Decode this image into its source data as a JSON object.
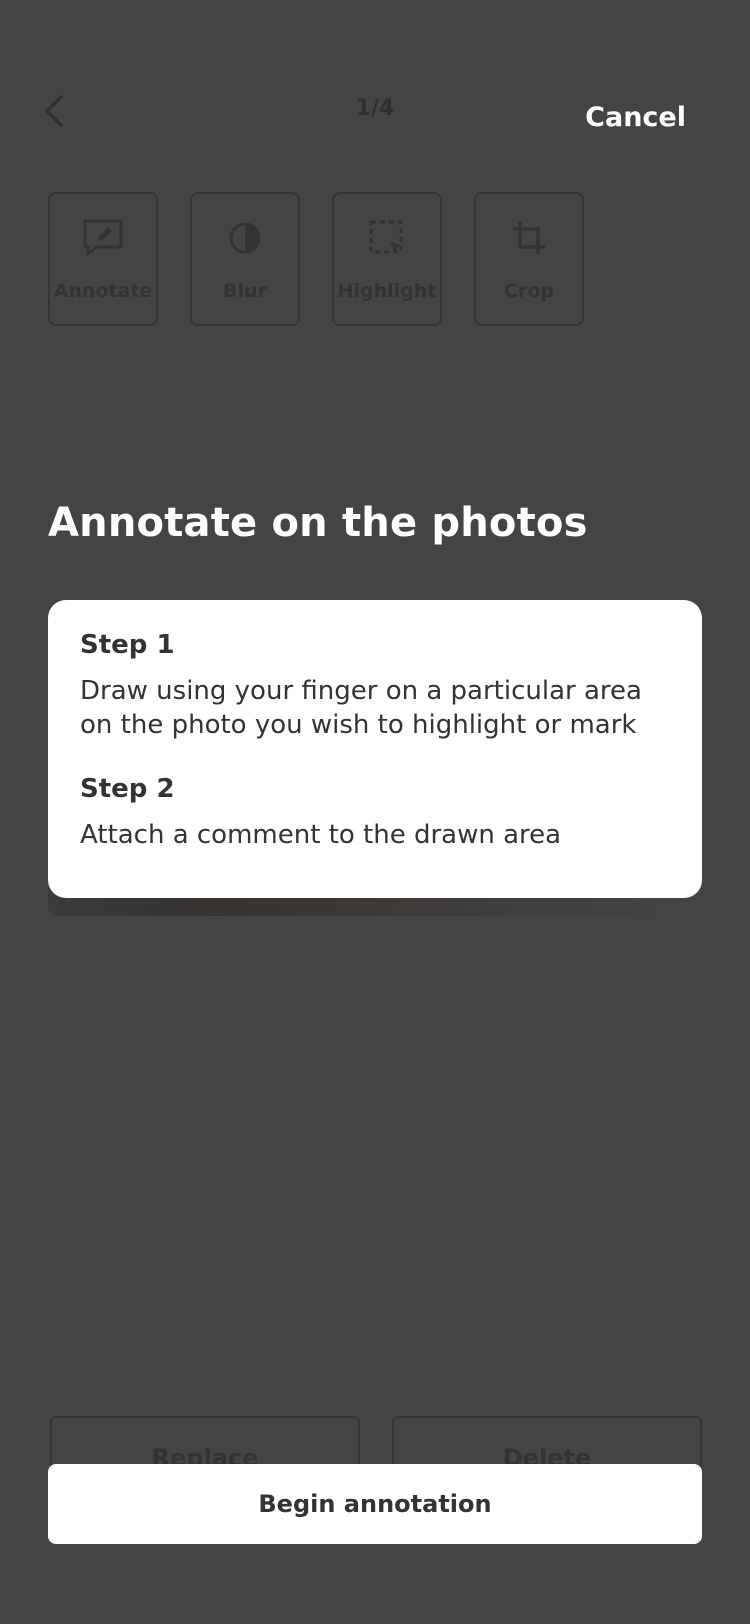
{
  "header": {
    "page_counter": "1/4",
    "cancel_label": "Cancel",
    "back_icon": "chevron-left-icon"
  },
  "tools": [
    {
      "label": "Annotate",
      "icon": "annotate-icon"
    },
    {
      "label": "Blur",
      "icon": "blur-icon"
    },
    {
      "label": "Highlight",
      "icon": "highlight-icon"
    },
    {
      "label": "Crop",
      "icon": "crop-icon"
    }
  ],
  "onboarding": {
    "title": "Annotate on the photos",
    "steps": [
      {
        "heading": "Step 1",
        "text": "Draw using your finger on a particular area on the photo you wish to highlight or mark"
      },
      {
        "heading": "Step 2",
        "text": "Attach a comment to the drawn area"
      }
    ],
    "cta_label": "Begin annotation"
  },
  "footer": {
    "replace_label": "Replace",
    "delete_label": "Delete"
  },
  "colors": {
    "overlay": "#444444",
    "card": "#ffffff",
    "text_dark": "#333333"
  }
}
